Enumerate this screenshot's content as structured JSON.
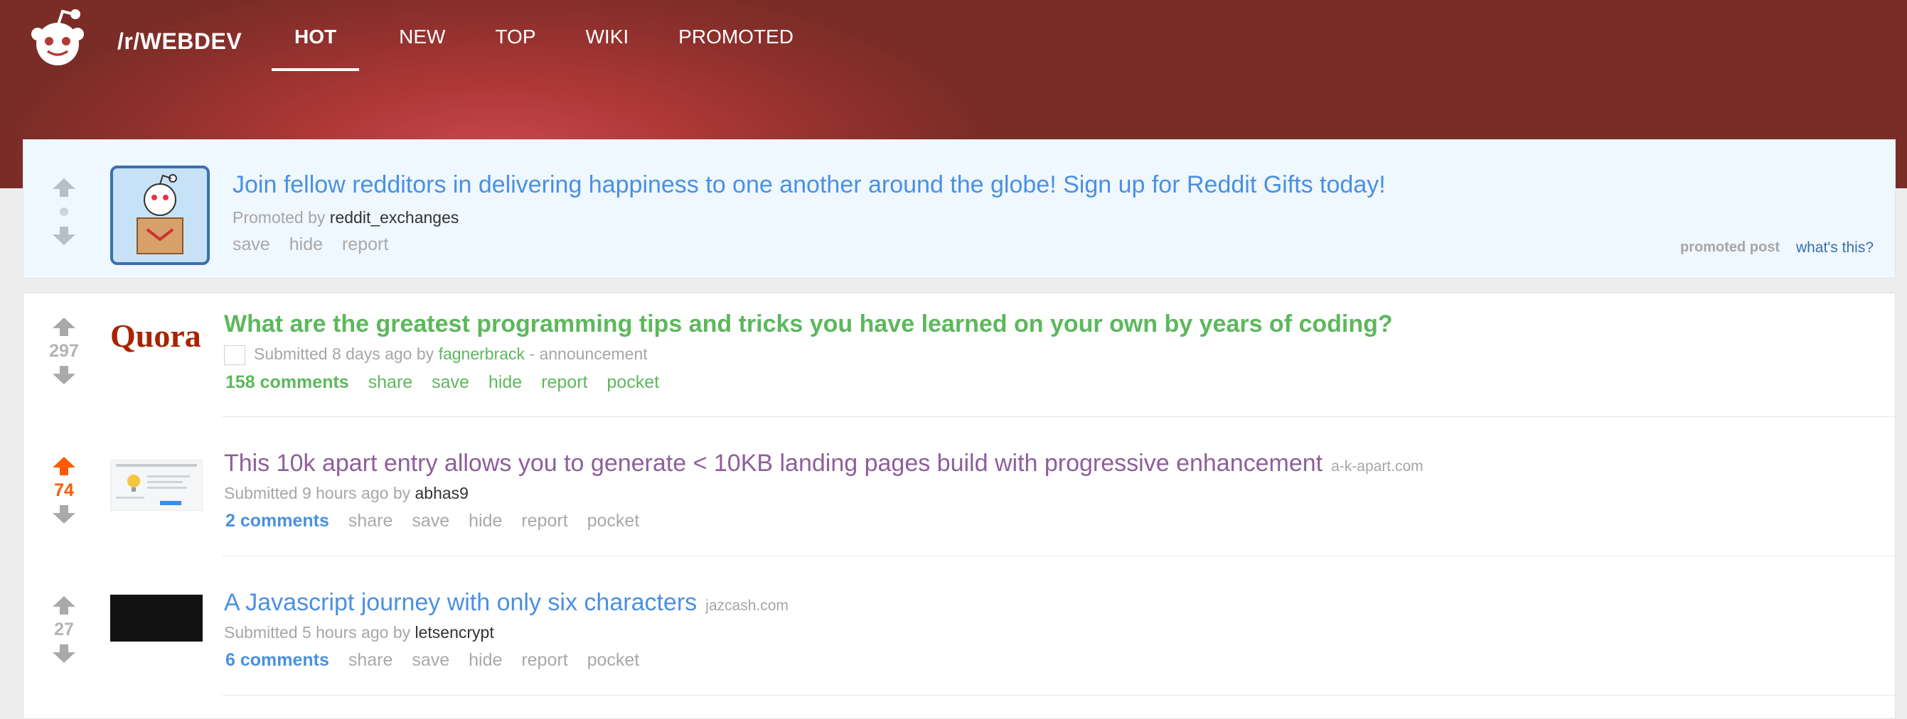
{
  "header": {
    "subreddit": "/r/WEBDEV",
    "tabs": [
      {
        "label": "HOT",
        "active": true
      },
      {
        "label": "NEW",
        "active": false
      },
      {
        "label": "TOP",
        "active": false
      },
      {
        "label": "WIKI",
        "active": false
      },
      {
        "label": "PROMOTED",
        "active": false
      }
    ]
  },
  "promoted": {
    "title": "Join fellow redditors in delivering happiness to one another around the globe! Sign up for Reddit Gifts today!",
    "promoted_by_prefix": "Promoted by",
    "author": "reddit_exchanges",
    "actions": [
      "save",
      "hide",
      "report"
    ],
    "label": "promoted post",
    "whats_this": "what's this?"
  },
  "posts": [
    {
      "score": "297",
      "thumbnail_text": "Quora",
      "title": "What are the greatest programming tips and tricks you have learned on your own by years of coding?",
      "domain": "",
      "submitted": "Submitted 8 days ago by",
      "author": "fagnerbrack",
      "flair": "- announcement",
      "comments": "158 comments",
      "actions": [
        "share",
        "save",
        "hide",
        "report",
        "pocket"
      ]
    },
    {
      "score": "74",
      "title": "This 10k apart entry allows you to generate < 10KB landing pages build with progressive enhancement",
      "domain": "a-k-apart.com",
      "submitted": "Submitted 9 hours ago by",
      "author": "abhas9",
      "comments": "2 comments",
      "actions": [
        "share",
        "save",
        "hide",
        "report",
        "pocket"
      ]
    },
    {
      "score": "27",
      "title": "A Javascript journey with only six characters",
      "domain": "jazcash.com",
      "submitted": "Submitted 5 hours ago by",
      "author": "letsencrypt",
      "comments": "6 comments",
      "actions": [
        "share",
        "save",
        "hide",
        "report",
        "pocket"
      ]
    }
  ],
  "colors": {
    "header_red": "#ad3836",
    "link_blue": "#4a90e2",
    "sticky_green": "#5cb85c",
    "visited_purple": "#8d5f9b",
    "upvoted_orange": "#ff5a00"
  }
}
